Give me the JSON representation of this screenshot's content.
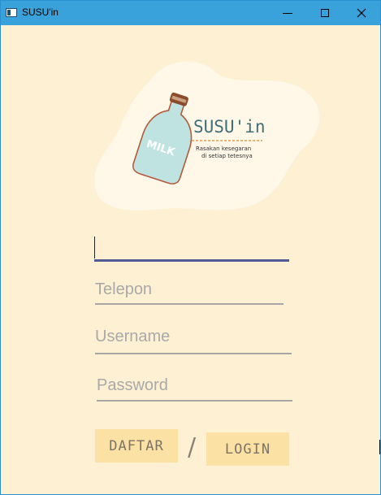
{
  "window": {
    "title": "SUSU'in",
    "controls": {
      "minimize": "minimize-icon",
      "maximize": "maximize-icon",
      "close": "close-icon"
    }
  },
  "logo": {
    "brand": "SUSU'in",
    "tagline_line1": "Rasakan kesegaran",
    "tagline_line2": "di setiap tetesnya",
    "bottle_label": "MILK"
  },
  "form": {
    "name_value": "",
    "telepon_placeholder": "Telepon",
    "username_placeholder": "Username",
    "password_placeholder": "Password"
  },
  "buttons": {
    "daftar": "DAFTAR",
    "separator": "/",
    "login": "LOGIN"
  },
  "colors": {
    "background": "#fdf0d3",
    "titlebar": "#3aa2db",
    "button": "#fbe1a3",
    "active_underline": "#4f5a97"
  }
}
